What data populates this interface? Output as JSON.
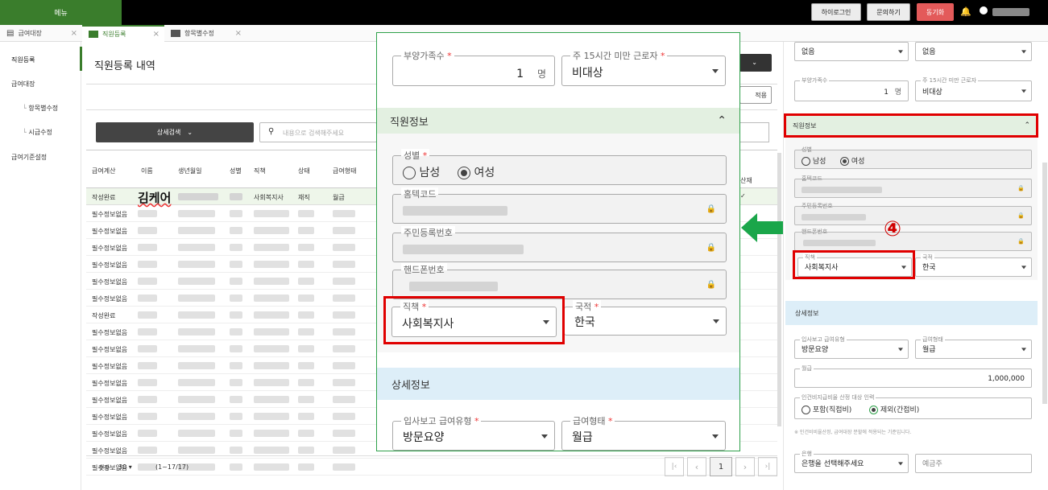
{
  "topbar": {
    "menu": "메뉴",
    "hi_login": "하이로그인",
    "inquiry": "문의하기",
    "sync": "동기화"
  },
  "tabs": [
    {
      "label": "급여대장"
    },
    {
      "label": "직원등록"
    },
    {
      "label": "항목별수정"
    }
  ],
  "sidebar": {
    "items": [
      "직원등록",
      "급여대장",
      "항목별수정",
      "시급수정",
      "급여기준설정"
    ]
  },
  "main": {
    "title": "직원등록 내역",
    "detail_search": "상세검색",
    "search_placeholder": "내용으로 검색해주세요",
    "headers": [
      "급여계산",
      "이름",
      "생년월일",
      "성별",
      "직책",
      "상태",
      "급여형태"
    ],
    "extra_header": "산재",
    "first_row": {
      "calc": "작성완료",
      "name": "김케어",
      "position": "사회복지사",
      "status": "재직",
      "pay": "월급",
      "check": "✓"
    },
    "rows": [
      "필수정보없음",
      "필수정보없음",
      "필수정보없음",
      "필수정보없음",
      "필수정보없음",
      "필수정보없음",
      "작성완료",
      "필수정보없음",
      "필수정보없음",
      "필수정보없음",
      "필수정보없음",
      "필수정보없음",
      "필수정보없음",
      "필수정보없음",
      "필수정보없음",
      "필수정보없음"
    ],
    "page_size_label": "갯수",
    "page_size": "30",
    "range": "(1~17/17)",
    "page": "1",
    "apply": "적용"
  },
  "modal": {
    "dependents": {
      "label": "부양가족수",
      "value": "1",
      "unit": "명"
    },
    "under15": {
      "label": "주 15시간 미만 근로자",
      "value": "비대상"
    },
    "section_employee": "직원정보",
    "gender": {
      "label": "성별",
      "male": "남성",
      "female": "여성"
    },
    "hometax": {
      "label": "홈텍코드"
    },
    "rrn": {
      "label": "주민등록번호"
    },
    "phone": {
      "label": "핸드폰번호"
    },
    "position": {
      "label": "직책",
      "value": "사회복지사"
    },
    "nationality": {
      "label": "국적",
      "value": "한국"
    },
    "section_detail": "상세정보",
    "report_type": {
      "label": "입사보고 급여유형",
      "value": "방문요양"
    },
    "pay_type": {
      "label": "급여형태",
      "value": "월급"
    }
  },
  "right": {
    "top1": "없음",
    "top2": "없음",
    "dependents": {
      "label": "부양가족수",
      "value": "1",
      "unit": "명"
    },
    "under15": {
      "label": "주 15시간 미만 근로자",
      "value": "비대상"
    },
    "section_employee": "직원정보",
    "gender": {
      "label": "성별",
      "male": "남성",
      "female": "여성"
    },
    "hometax": "홈텍코드",
    "rrn": "주민등록번호",
    "phone": "핸드폰번호",
    "position": {
      "label": "직책",
      "value": "사회복지사"
    },
    "nationality": {
      "label": "국적",
      "value": "한국"
    },
    "step": "④",
    "section_detail": "상세정보",
    "report_type": {
      "label": "입사보고 급여유형",
      "value": "방문요양"
    },
    "pay_type": {
      "label": "급여형태",
      "value": "월급"
    },
    "salary": {
      "label": "월급",
      "value": "1,000,000"
    },
    "labor": {
      "label": "인건비지급비율 산정 대상 인력",
      "include": "포함(직접비)",
      "exclude": "제외(간접비)"
    },
    "note": "※ 인건비비율산정, 급여대장 분할에 적용되는 기준입니다.",
    "bank": {
      "label": "은행",
      "placeholder": "은행을 선택해주세요"
    },
    "holder": "예금주"
  },
  "colors": {
    "green": "#3a7d2c",
    "red": "#e00000",
    "arrow": "#1aa64a"
  }
}
